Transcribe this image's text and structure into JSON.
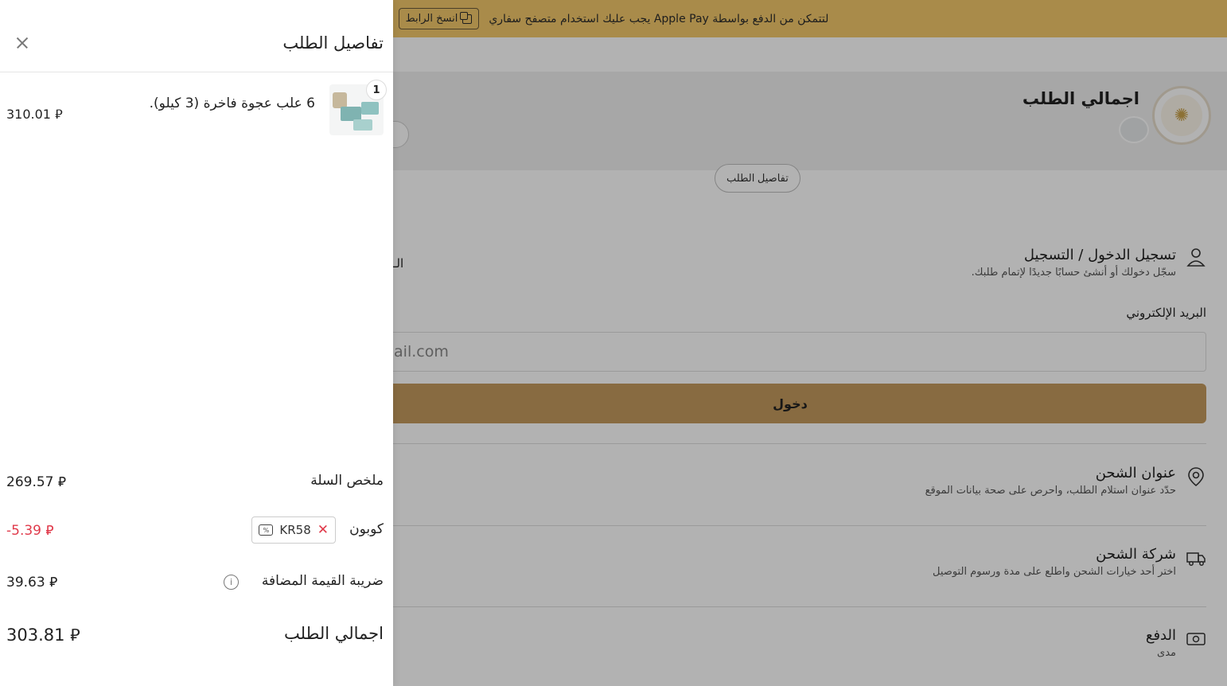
{
  "banner": {
    "message": "لتتمكن من الدفع بواسطة Apple Pay يجب عليك استخدام متصفح سفاري",
    "copy_link_label": "انسخ الرابط"
  },
  "summary": {
    "title": "اجمالي الطلب",
    "details_button": "تفاصيل الطلب"
  },
  "checkout": {
    "login": {
      "title": "تسجيل الدخول / التسجيل",
      "subtitle": "سجّل دخولك أو أنشئ حسابًا جديدًا لإتمام طلبك.",
      "email_label": "البريد الإلكتروني",
      "email_placeholder": "nail.com",
      "login_button": "دخول"
    },
    "shipping_address": {
      "title": "عنوان الشحن",
      "subtitle": "حدّد عنوان استلام الطلب، واحرص على صحة بيانات الموقع"
    },
    "shipping_company": {
      "title": "شركة الشحن",
      "subtitle": "اختر أحد خيارات الشحن واطلع على مدة ورسوم التوصيل"
    },
    "payment": {
      "title": "الدفع",
      "subtitle": "مدى"
    },
    "partial_label": "الـ"
  },
  "drawer": {
    "title": "تفاصيل الطلب",
    "item": {
      "quantity": "1",
      "name": "6 علب عجوة فاخرة (3 كيلو).",
      "price": "310.01 ⃁"
    },
    "cart_summary": {
      "label": "ملخص السلة",
      "value": "269.57 ⃁"
    },
    "coupon": {
      "label": "كوبون",
      "code": "KR58",
      "remove": "✕",
      "value": "-5.39 ⃁"
    },
    "vat": {
      "label": "ضريبة القيمة المضافة",
      "info": "i",
      "value": "39.63 ⃁"
    },
    "total": {
      "label": "اجمالي الطلب",
      "value": "303.81 ⃁"
    }
  },
  "colors": {
    "banner": "#f3c86a",
    "login_button": "#c39a5e",
    "discount": "#e03a4b"
  }
}
